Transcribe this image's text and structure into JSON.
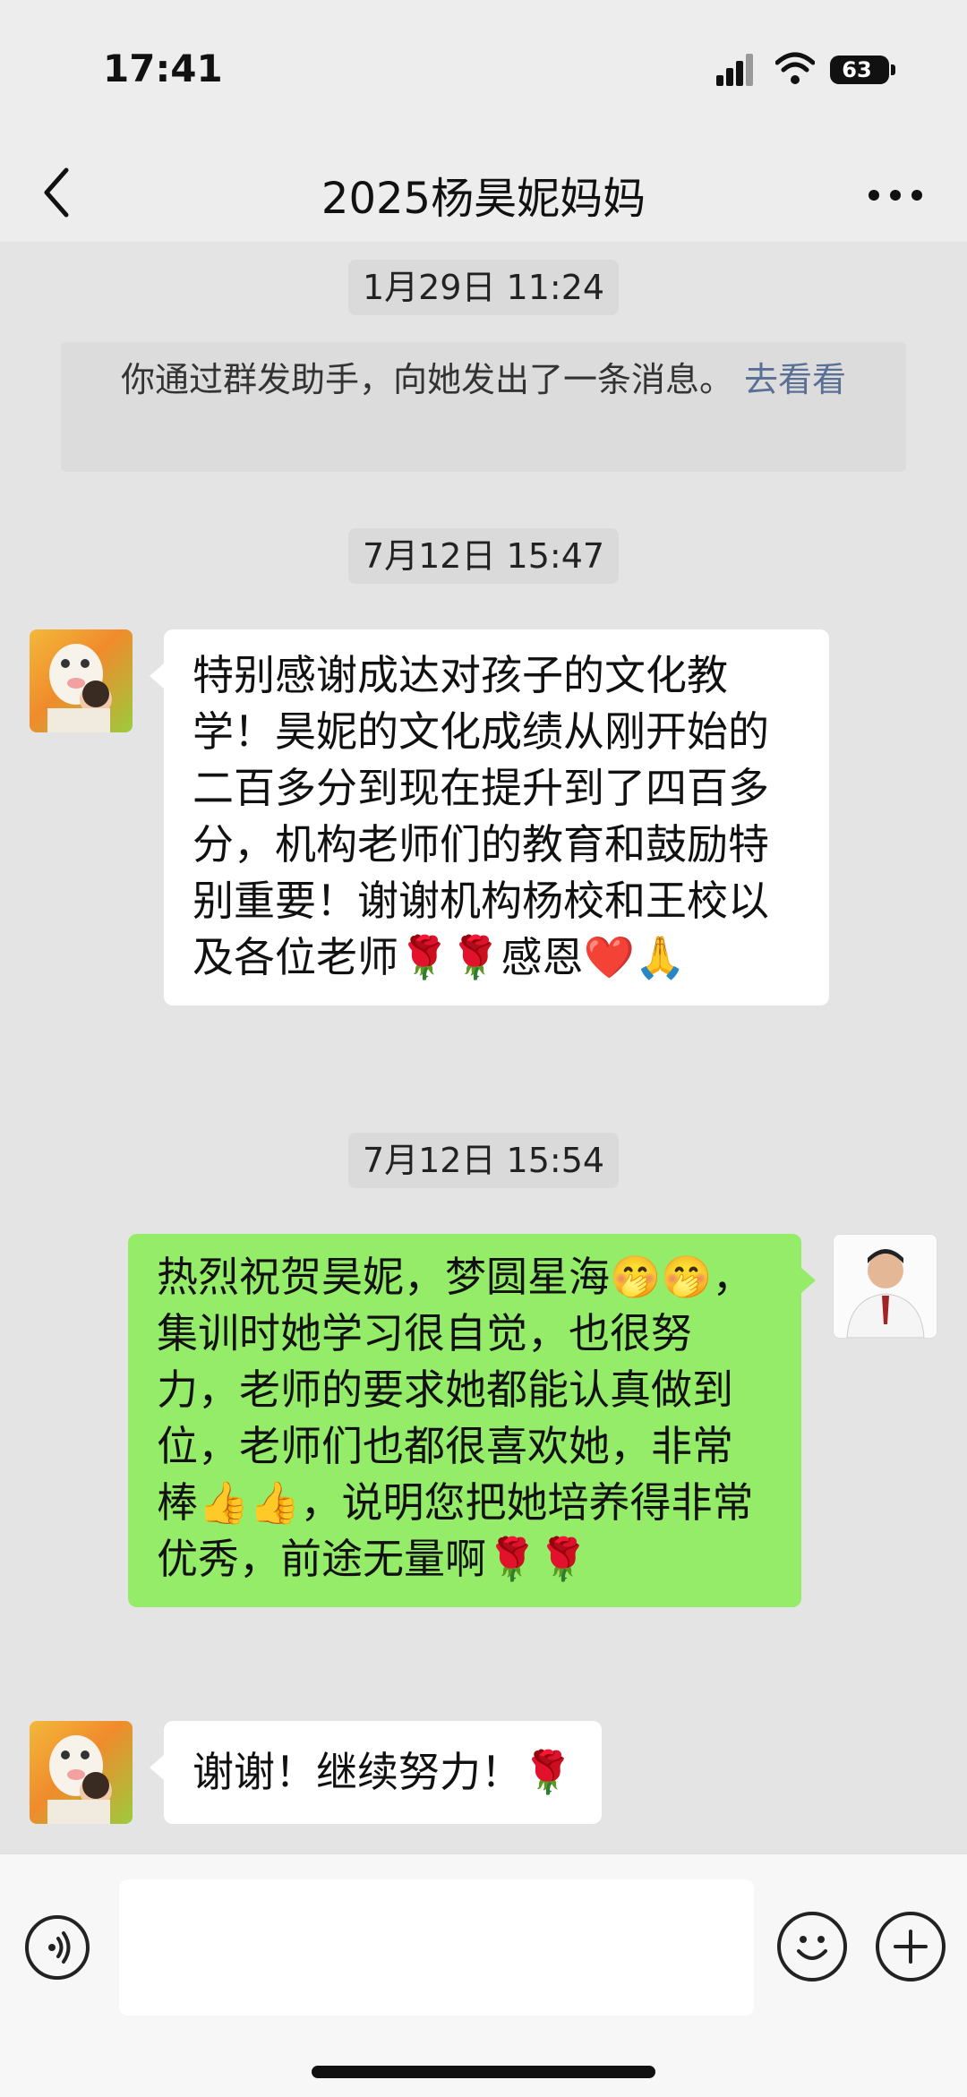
{
  "status_bar": {
    "time": "17:41",
    "battery": "63",
    "icons": [
      "signal-icon",
      "wifi-icon",
      "battery-icon"
    ]
  },
  "nav": {
    "title": "2025杨昊妮妈妈",
    "back_icon": "chevron-left-icon",
    "more_icon": "ellipsis-icon"
  },
  "chat": {
    "timestamps": [
      "1月29日 11:24",
      "7月12日 15:47",
      "7月12日 15:54"
    ],
    "system_notice": {
      "text": "你通过群发助手，向她发出了一条消息。",
      "link": "去看看"
    },
    "messages": [
      {
        "sender": "contact",
        "text": "特别感谢成达对孩子的文化教学！昊妮的文化成绩从刚开始的二百多分到现在提升到了四百多分，机构老师们的教育和鼓励特别重要！谢谢机构杨校和王校以及各位老师🌹🌹感恩❤️🙏"
      },
      {
        "sender": "me",
        "text": "热烈祝贺昊妮，梦圆星海🤭🤭，集训时她学习很自觉，也很努力，老师的要求她都能认真做到位，老师们也都很喜欢她，非常棒👍👍，说明您把她培养得非常优秀，前途无量啊🌹🌹"
      },
      {
        "sender": "contact",
        "text": "谢谢！继续努力！🌹"
      }
    ]
  },
  "input_bar": {
    "input_value": "",
    "icons": [
      "voice-icon",
      "emoji-icon",
      "plus-icon"
    ]
  },
  "colors": {
    "background": "#ededed",
    "chat_bg": "#e4e4e4",
    "outgoing_bubble": "#95ec69",
    "incoming_bubble": "#ffffff",
    "link": "#5a6f94"
  }
}
